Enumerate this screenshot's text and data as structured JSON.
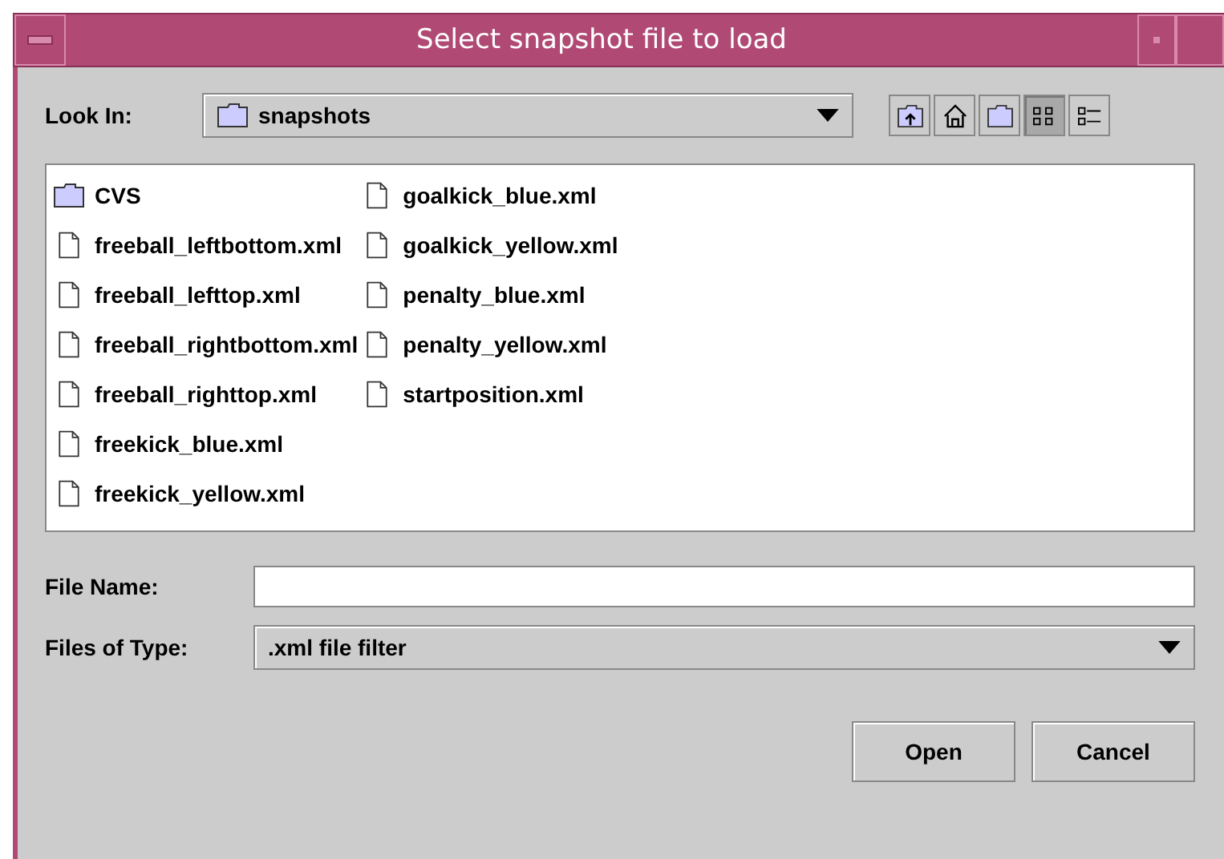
{
  "window": {
    "title": "Select snapshot file to load"
  },
  "look_in": {
    "label": "Look In:",
    "value": "snapshots"
  },
  "toolbar": [
    {
      "kind": "up",
      "selected": false
    },
    {
      "kind": "home",
      "selected": false
    },
    {
      "kind": "newfolder",
      "selected": false
    },
    {
      "kind": "list",
      "selected": true
    },
    {
      "kind": "details",
      "selected": false
    }
  ],
  "files": [
    {
      "name": "CVS",
      "kind": "folder"
    },
    {
      "name": "freeball_leftbottom.xml",
      "kind": "file"
    },
    {
      "name": "freeball_lefttop.xml",
      "kind": "file"
    },
    {
      "name": "freeball_rightbottom.xml",
      "kind": "file"
    },
    {
      "name": "freeball_righttop.xml",
      "kind": "file"
    },
    {
      "name": "freekick_blue.xml",
      "kind": "file"
    },
    {
      "name": "freekick_yellow.xml",
      "kind": "file"
    },
    {
      "name": "goalkick_blue.xml",
      "kind": "file"
    },
    {
      "name": "goalkick_yellow.xml",
      "kind": "file"
    },
    {
      "name": "penalty_blue.xml",
      "kind": "file"
    },
    {
      "name": "penalty_yellow.xml",
      "kind": "file"
    },
    {
      "name": "startposition.xml",
      "kind": "file"
    }
  ],
  "file_name": {
    "label": "File Name:"
  },
  "files_of_type": {
    "label": "Files of Type:",
    "value": ".xml file filter"
  },
  "buttons": [
    "Open",
    "Cancel"
  ]
}
